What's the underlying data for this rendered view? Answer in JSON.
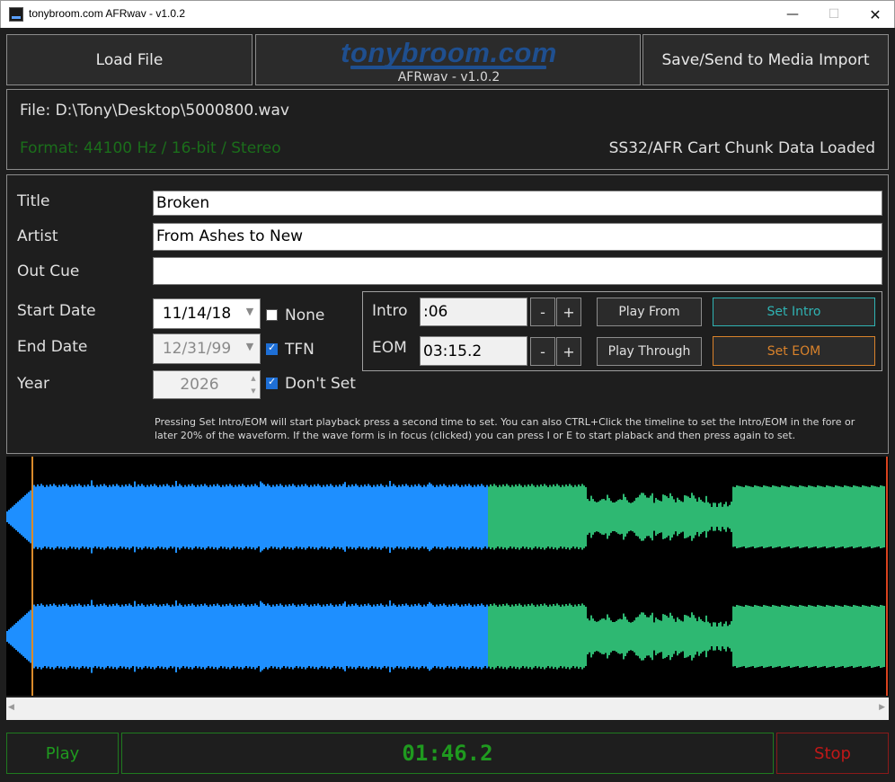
{
  "window": {
    "title": "tonybroom.com AFRwav - v1.0.2",
    "minimize_glyph": "—",
    "maximize_glyph": "☐",
    "close_glyph": "✕"
  },
  "toolbar": {
    "load_label": "Load File",
    "logo_text": "tonybroom.com",
    "version": "AFRwav - v1.0.2",
    "save_label": "Save/Send to Media Import"
  },
  "file_info": {
    "path": "File: D:\\Tony\\Desktop\\5000800.wav",
    "format": "Format: 44100 Hz / 16-bit / Stereo",
    "cart_status": "SS32/AFR Cart Chunk Data Loaded"
  },
  "metadata": {
    "title_label": "Title",
    "title_value": "Broken",
    "artist_label": "Artist",
    "artist_value": "From Ashes to New",
    "outcue_label": "Out Cue",
    "outcue_value": "",
    "start_date_label": "Start Date",
    "start_date_value": "11/14/18",
    "none_label": "None",
    "none_checked": false,
    "end_date_label": "End Date",
    "end_date_value": "12/31/99",
    "tfn_label": "TFN",
    "tfn_checked": true,
    "year_label": "Year",
    "year_value": "2026",
    "dont_set_label": "Don't Set",
    "dont_set_checked": true
  },
  "cues": {
    "intro_label": "Intro",
    "intro_value": ":06",
    "eom_label": "EOM",
    "eom_value": "03:15.2",
    "minus_label": "-",
    "plus_label": "+",
    "play_from_label": "Play From",
    "play_through_label": "Play Through",
    "set_intro_label": "Set Intro",
    "set_eom_label": "Set EOM"
  },
  "help": {
    "text": "Pressing Set Intro/EOM will start playback press a second time to set. You can also CTRL+Click the timeline to set the Intro/EOM in the fore or later 20% of the waveform. If the wave form is in focus (clicked) you can press I or E to start plaback and then press again to set."
  },
  "waveform": {
    "played_color": "#1e8fff",
    "remaining_color": "#2eb872",
    "intro_marker_color": "#d98a2b",
    "eom_marker_color": "#d9421e",
    "playhead_fraction": 0.545
  },
  "transport": {
    "play_label": "Play",
    "time": "01:46.2",
    "stop_label": "Stop"
  },
  "colors": {
    "background": "#1e1e1e",
    "green": "#1f9a1f",
    "red": "#c01818",
    "logo_blue": "#1f4f8f"
  }
}
